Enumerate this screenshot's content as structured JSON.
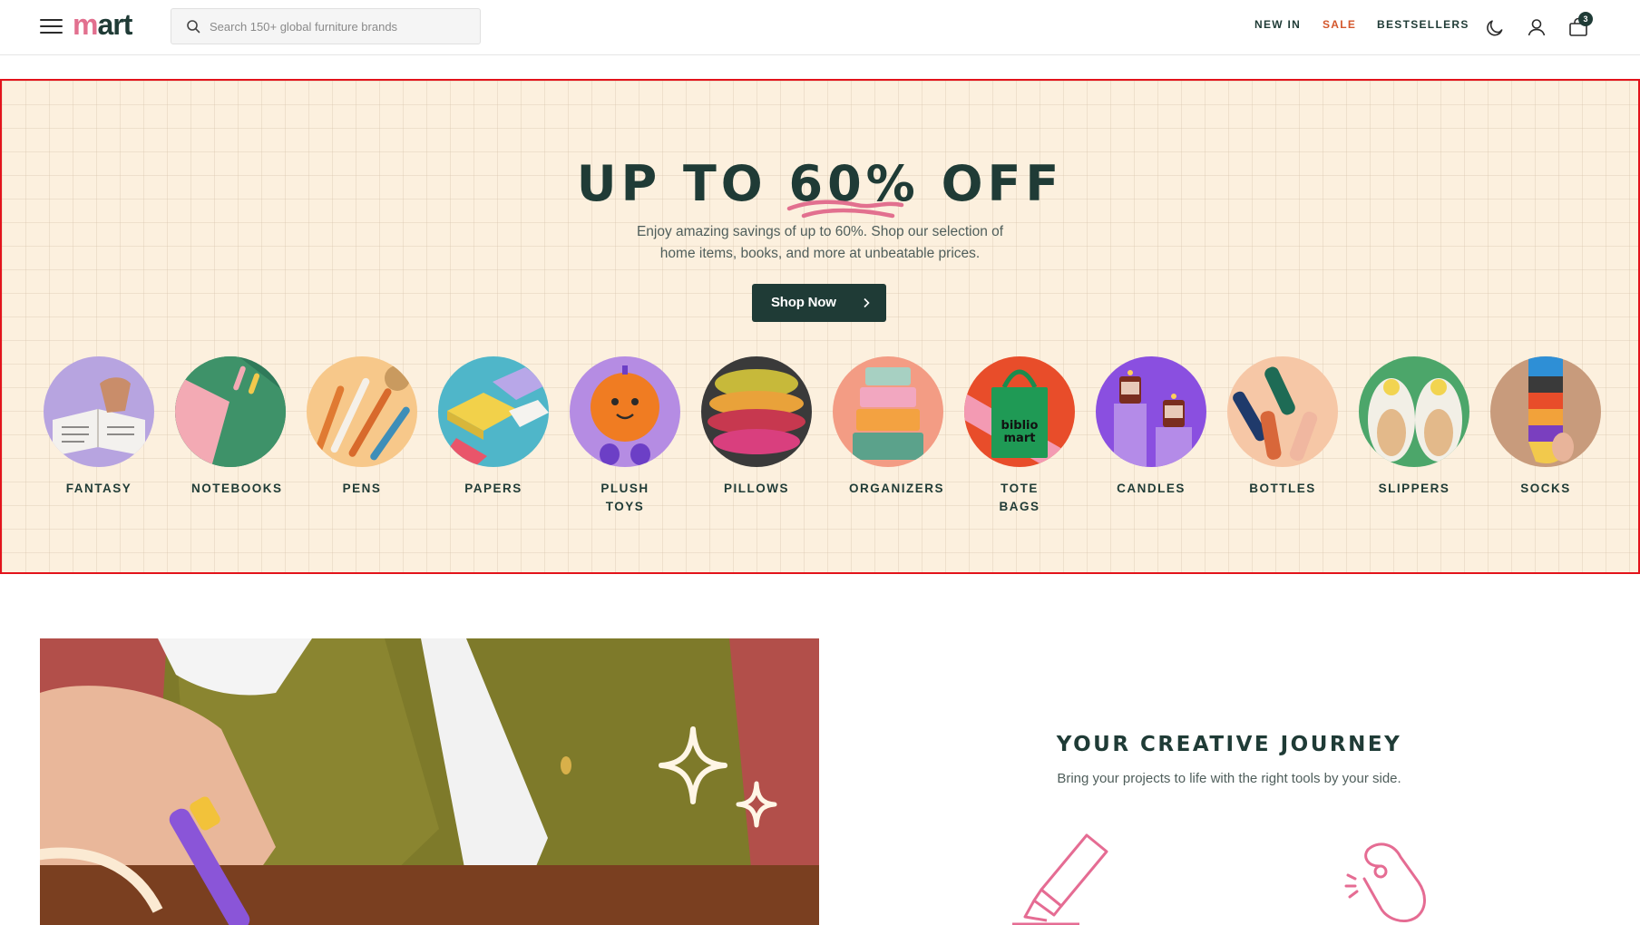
{
  "header": {
    "logo_m": "m",
    "logo_rest": "art",
    "search_placeholder": "Search 150+ global furniture brands",
    "nav": [
      {
        "label": "NEW IN"
      },
      {
        "label": "SALE",
        "color": "#d4572c"
      },
      {
        "label": "BESTSELLERS"
      }
    ],
    "cart_count": "3",
    "icons": [
      "menu-icon",
      "search-icon",
      "moon-icon",
      "user-icon",
      "bag-icon"
    ]
  },
  "hero": {
    "title_pre": "UP TO ",
    "title_highlight": "60%",
    "title_post": " OFF",
    "description": "Enjoy amazing savings of up to 60%. Shop our selection of home items, books, and more at unbeatable prices.",
    "cta": "Shop Now",
    "categories": [
      {
        "label": "FANTASY"
      },
      {
        "label": "NOTEBOOKS"
      },
      {
        "label": "PENS"
      },
      {
        "label": "PAPERS"
      },
      {
        "label": "PLUSH TOYS"
      },
      {
        "label": "PILLOWS"
      },
      {
        "label": "ORGANIZERS"
      },
      {
        "label": "TOTE BAGS"
      },
      {
        "label": "CANDLES"
      },
      {
        "label": "BOTTLES"
      },
      {
        "label": "SLIPPERS"
      },
      {
        "label": "SOCKS"
      }
    ]
  },
  "journey": {
    "title": "YOUR CREATIVE JOURNEY",
    "subtitle": "Bring your projects to life with the right tools by your side."
  },
  "colors": {
    "brand_dark": "#1f3b36",
    "brand_pink": "#e2708f",
    "sale": "#d4572c",
    "hero_bg": "#fcf0de",
    "highlight_border": "#e3131b"
  }
}
